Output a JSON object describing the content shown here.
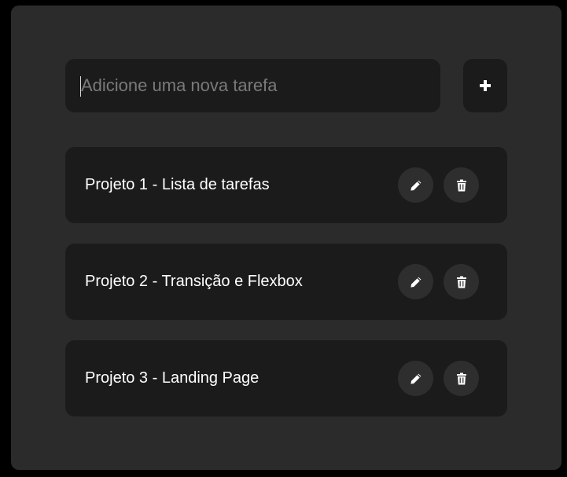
{
  "new_task": {
    "value": "",
    "placeholder": "Adicione uma nova tarefa",
    "add_icon": "plus-icon"
  },
  "tasks": [
    {
      "label": "Projeto 1 - Lista de tarefas",
      "edit_icon": "pencil-icon",
      "delete_icon": "trash-icon"
    },
    {
      "label": "Projeto 2 - Transição e Flexbox",
      "edit_icon": "pencil-icon",
      "delete_icon": "trash-icon"
    },
    {
      "label": "Projeto 3 - Landing Page",
      "edit_icon": "pencil-icon",
      "delete_icon": "trash-icon"
    }
  ],
  "colors": {
    "page_background": "#000000",
    "card_background": "#2b2b2b",
    "field_background": "#1b1b1b",
    "icon_button_background": "#2e2e2e",
    "text": "#ffffff",
    "placeholder": "#7a7a7a"
  }
}
